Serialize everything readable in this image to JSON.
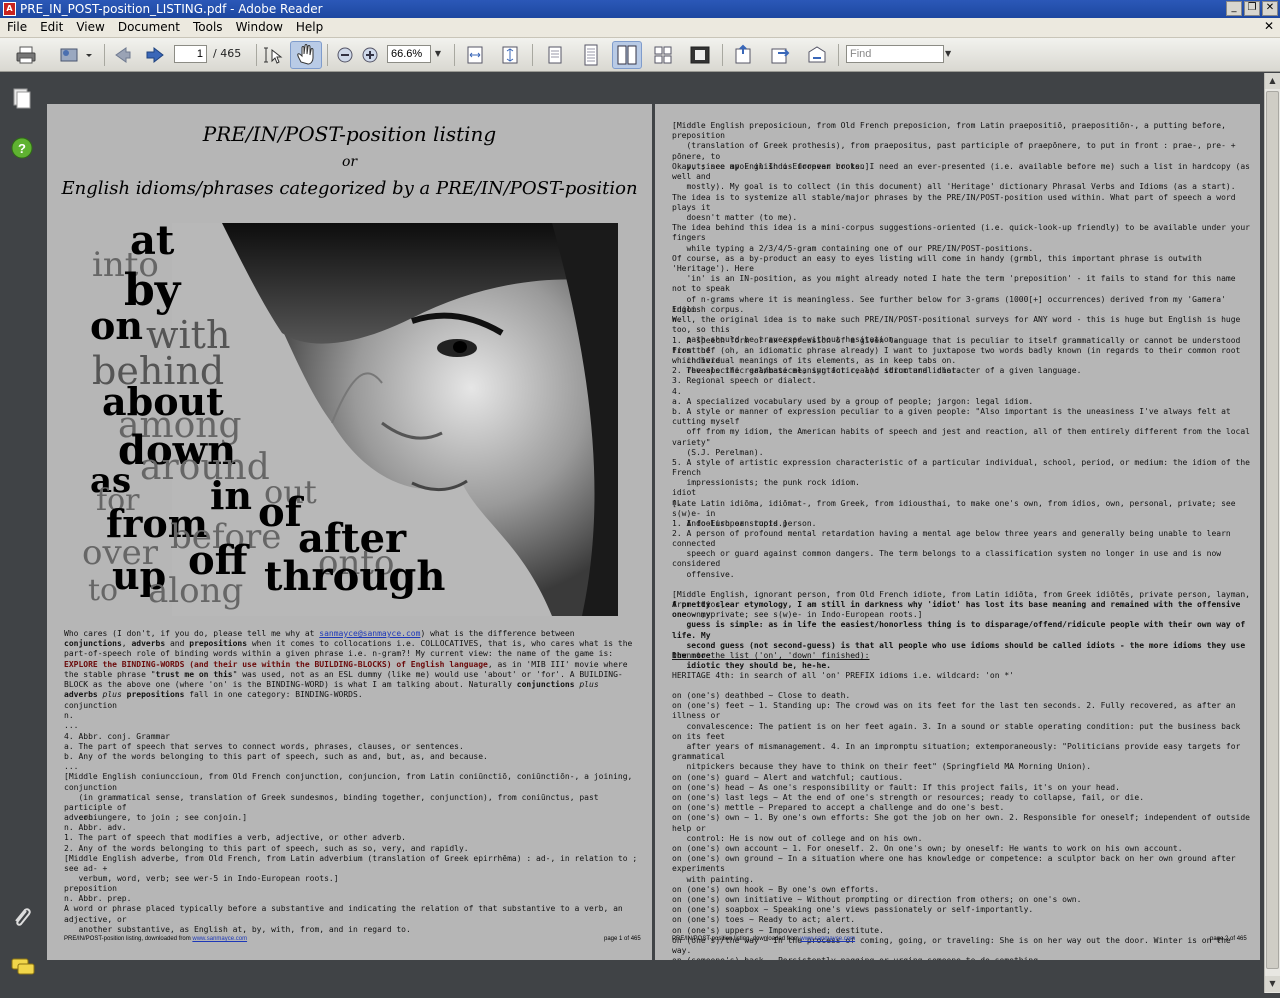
{
  "window": {
    "title": "PRE_IN_POST-position_LISTING.pdf - Adobe Reader",
    "minimize": "_",
    "restore": "❐",
    "close": "✕"
  },
  "menu": {
    "items": [
      "File",
      "Edit",
      "View",
      "Document",
      "Tools",
      "Window",
      "Help"
    ],
    "close_doc": "✕"
  },
  "toolbar": {
    "page_current": "1",
    "page_total": "/ 465",
    "zoom": "66.6%",
    "find_placeholder": "Find"
  },
  "page1": {
    "title": "PRE/IN/POST-position listing",
    "or": "or",
    "subtitle": "English idioms/phrases categorized by a PRE/IN/POST-position",
    "hero_words": [
      "at",
      "into",
      "by",
      "on",
      "with",
      "behind",
      "about",
      "among",
      "down",
      "around",
      "as",
      "in",
      "out",
      "for",
      "of",
      "from",
      "after",
      "before",
      "onto",
      "over",
      "up",
      "off",
      "through",
      "to",
      "along"
    ],
    "intro": {
      "t1": "Who cares (I don't, if you do, please tell me why at ",
      "email": "sanmayce@sanmayce.com",
      "t2": ") what is the difference between ",
      "b1": "conjunctions",
      "t3": ", ",
      "b2": "adverbs",
      "t4": " and ",
      "b3": "prepositions",
      "t5": " when it comes to collocations i.e. COLLOCATIVES, that is, who cares what is the part-of-speech role of binding words within a given phrase i.e. n-gram?! My current view: the name of the game is: ",
      "r1": "EXPLORE the BINDING-WORDS (and their use within the BUILDING-BLOCKS) of English language",
      "t6": ", as in 'MIB III' movie where the stable phrase \"",
      "b4": "trust me on this",
      "t7": "\" was used, not as an ESL dummy (like me) would use 'about' or 'for'. A BUILDING-BLOCK as the above one (where 'on' is the BINDING-WORD) is what I am talking about. Naturally ",
      "b5": "conjunctions",
      "t8": " plus ",
      "b6": "adverbs",
      "t9": " plus ",
      "b7": "prepositions",
      "t10": " fall in one category: BINDING-WORDS."
    },
    "conjunction": "conjunction\nn.\n...\n4. Abbr. conj. Grammar\na. The part of speech that serves to connect words, phrases, clauses, or sentences.\nb. Any of the words belonging to this part of speech, such as and, but, as, and because.\n...\n[Middle English coniunccioun, from Old French conjunction, conjuncion, from Latin coniūnctiō, coniūnctiōn-, a joining, conjunction\n   (in grammatical sense, translation of Greek sundesmos, binding together, conjunction), from coniūnctus, past participle of\n   coniungere, to join ; see conjoin.]",
    "adverb": "adverb\nn. Abbr. adv.\n1. The part of speech that modifies a verb, adjective, or other adverb.\n2. Any of the words belonging to this part of speech, such as so, very, and rapidly.\n[Middle English adverbe, from Old French, from Latin adverbium (translation of Greek epirrhēma) : ad-, in relation to ; see ad- +\n   verbum, word, verb; see wer-5 in Indo-European roots.]",
    "preposition": "preposition\nn. Abbr. prep.\nA word or phrase placed typically before a substantive and indicating the relation of that substantive to a verb, an adjective, or\n   another substantive, as English at, by, with, from, and in regard to.",
    "footer_text": "PRE/IN/POST-position listing, downloaded from ",
    "footer_link": "www.sanmayce.com",
    "footer_page": "page 1 of 465"
  },
  "page2": {
    "etym": "[Middle English preposicioun, from Old French preposicion, from Latin praepositiō, praepositiōn-, a putting before, preposition\n   (translation of Greek prothesis), from praepositus, past participle of praepōnere, to put in front : prae-, pre- + pōnere, to\n   put; see apo- in Indo-European roots.]",
    "intro": "Okay, since my English is forever broken I need an ever-presented (i.e. available before me) such a list in hardcopy (as well and\n   mostly). My goal is to collect (in this document) all 'Heritage' dictionary Phrasal Verbs and Idioms (as a start).\nThe idea is to systemize all stable/major phrases by the PRE/IN/POST-position used within. What part of speech a word plays it\n   doesn't matter (to me).\nThe idea behind this idea is a mini-corpus suggestions-oriented (i.e. quick-look-up friendly) to be available under your fingers\n   while typing a 2/3/4/5-gram containing one of our PRE/IN/POST-positions.\nOf course, as a by-product an easy to eyes listing will come in handy (grmbl, this important phrase is outwith 'Heritage'). Here\n   'in' is an IN-position, as you might already noted I hate the term 'preposition' - it fails to stand for this name not to speak\n   of n-grams where it is meaningless. See further below for 3-grams (1000[+] occurrences) derived from my 'Gamera' English corpus.\nWell, the original idea is to make such PRE/IN/POST-positional surveys for ANY word - this is huge but English is huge too, so this\n   path should be traversed without hesitation.\nFirst off (oh, an idiomatic phrase already) I want to juxtapose two words badly known (in regards to their common root which here\n   reveals the real/base meaning for real): idiom and idiot.",
    "idiom": "idiom\nn.\n\n1. A speech form or an expression of a given language that is peculiar to itself grammatically or cannot be understood from the\n   individual meanings of its elements, as in keep tabs on.\n2. The specific grammatical, syntactic, and structural character of a given language.\n3. Regional speech or dialect.\n4.\na. A specialized vocabulary used by a group of people; jargon: legal idiom.\nb. A style or manner of expression peculiar to a given people: \"Also important is the uneasiness I've always felt at cutting myself\n   off from my idiom, the American habits of speech and jest and reaction, all of them entirely different from the local variety\"\n   (S.J. Perelman).\n5. A style of artistic expression characteristic of a particular individual, school, period, or medium: the idiom of the French\n   impressionists; the punk rock idiom.\n\n[Late Latin idiōma, idiōmat-, from Greek, from idiousthai, to make one's own, from idios, own, personal, private; see s(w)e- in\n   Indo-European roots.]",
    "idiot": "idiot\nn.\n\n1. A foolish or stupid person.\n2. A person of profound mental retardation having a mental age below three years and generally being unable to learn connected\n   speech or guard against common dangers. The term belongs to a classification system no longer in use and is now considered\n   offensive.\n\n[Middle English, ignorant person, from Old French idiote, from Latin idiōta, from Greek idiōtēs, private person, layman, from idios,\n   own, private; see s(w)e- in Indo-European roots.]",
    "pretty": "A pretty clear etymology, I am still in darkness why 'idiot' has lost its base meaning and remained with the offensive one - my\n   guess is simple: as in life the easiest/honorless thing is to disparage/offend/ridicule people with their own way of life. My\n   second guess (not second-guess) is that all people who use idioms should be called idiots - the more idioms they use the more\n   idiotic they should be, he-he.",
    "down": "Down to the list ('on', 'down' finished):",
    "heritage": "HERITAGE 4th: in search of all 'on' PREFIX idioms i.e. wildcard: 'on *'",
    "list": "on (one's) deathbed ~ Close to death.\non (one's) feet ~ 1. Standing up: The crowd was on its feet for the last ten seconds. 2. Fully recovered, as after an illness or\n   convalescence: The patient is on her feet again. 3. In a sound or stable operating condition: put the business back on its feet\n   after years of mismanagement. 4. In an impromptu situation; extemporaneously: \"Politicians provide easy targets for grammatical\n   nitpickers because they have to think on their feet\" (Springfield MA Morning Union).\non (one's) guard ~ Alert and watchful; cautious.\non (one's) head ~ As one's responsibility or fault: If this project fails, it's on your head.\non (one's) last legs ~ At the end of one's strength or resources; ready to collapse, fail, or die.\non (one's) mettle ~ Prepared to accept a challenge and do one's best.\non (one's) own ~ 1. By one's own efforts: She got the job on her own. 2. Responsible for oneself; independent of outside help or\n   control: He is now out of college and on his own.\non (one's) own account ~ 1. For oneself. 2. On one's own; by oneself: He wants to work on his own account.\non (one's) own ground ~ In a situation where one has knowledge or competence: a sculptor back on her own ground after experiments\n   with painting.\non (one's) own hook ~ By one's own efforts.\non (one's) own initiative ~ Without prompting or direction from others; on one's own.\non (one's) soapbox ~ Speaking one's views passionately or self-importantly.\non (one's) toes ~ Ready to act; alert.\non (one's) uppers ~ Impoverished; destitute.\non (one's)/the way ~ In the process of coming, going, or traveling: She is on her way out the door. Winter is on the way.\non (someone's) back ~ Persistently nagging or urging someone to do something.\non (someone's) case ~ Persistently nagging or urging someone to do something.\non a bowline ~ Close-hauled.",
    "footer_text": "PRE/IN/POST-position listing, downloaded from ",
    "footer_link": "www.sanmayce.com",
    "footer_page": "page 2 of 465"
  }
}
